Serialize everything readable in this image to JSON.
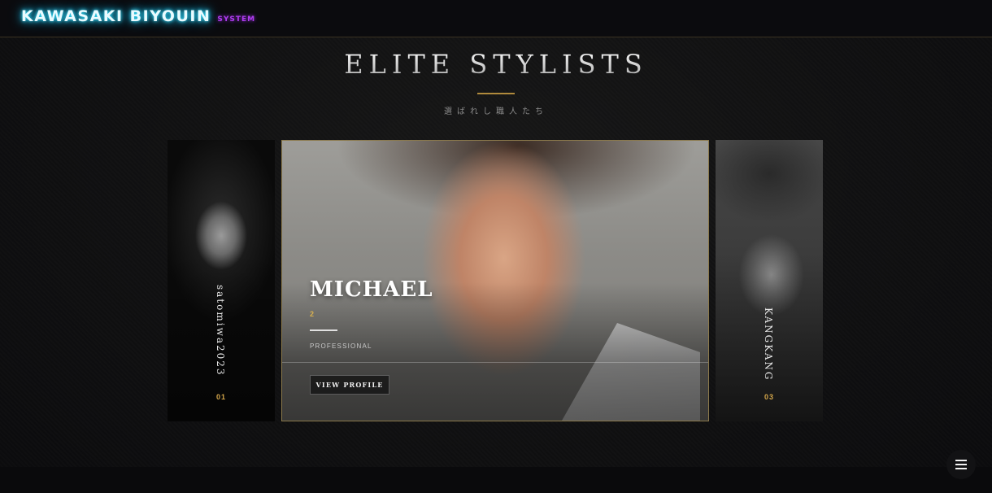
{
  "header": {
    "brand": "KAWASAKI BIYOUIN",
    "brand_sub": "SYSTEM"
  },
  "section": {
    "title": "ELITE STYLISTS",
    "subtitle": "選ばれし職人たち"
  },
  "stylists": [
    {
      "name": "satomiwa2023",
      "number": "01"
    },
    {
      "name": "MICHAEL",
      "number": "2",
      "role": "PROFESSIONAL",
      "button": "VIEW PROFILE"
    },
    {
      "name": "KANGKANG",
      "number": "03"
    }
  ],
  "icons": {
    "menu": "hamburger-menu-icon"
  },
  "colors": {
    "brand_glow": "#38e3ff",
    "brand_sub": "#b03cf0",
    "accent_gold": "#b08a3c",
    "number_gold": "#d4a64a",
    "background": "#0c0c0e"
  }
}
